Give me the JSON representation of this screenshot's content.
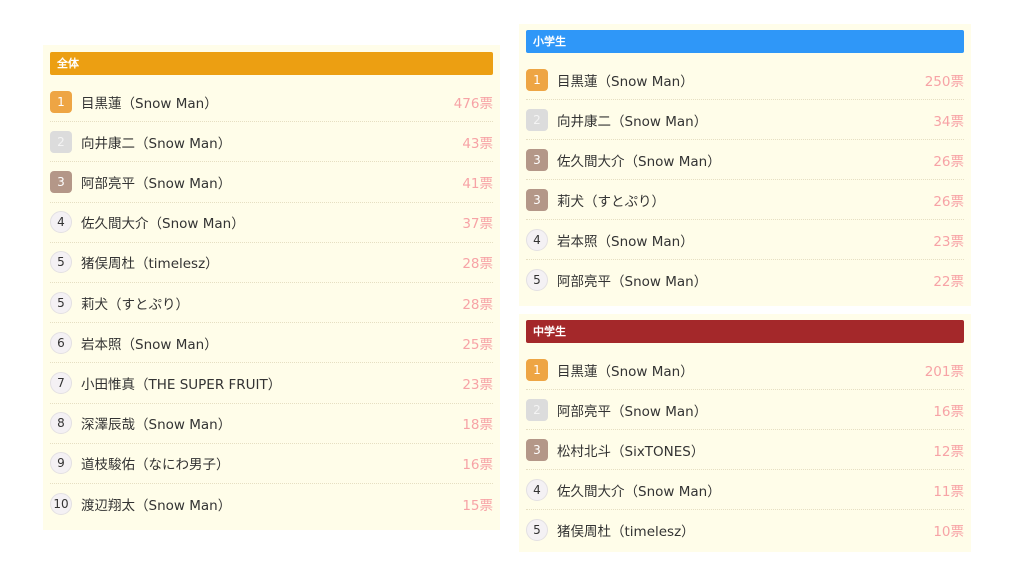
{
  "colors": {
    "all_header": "#ec9f12",
    "elementary_header": "#2f97f8",
    "junior_header": "#a4282a",
    "panel_bg": "#fffde9",
    "votes_text": "#f7a3a6"
  },
  "panels": {
    "all": {
      "title": "全体",
      "rows": [
        {
          "rank": "1",
          "medal": "gold",
          "name": "目黒蓮（Snow Man）",
          "votes": "476票"
        },
        {
          "rank": "2",
          "medal": "silver",
          "name": "向井康二（Snow Man）",
          "votes": "43票"
        },
        {
          "rank": "3",
          "medal": "bronze",
          "name": "阿部亮平（Snow Man）",
          "votes": "41票"
        },
        {
          "rank": "4",
          "medal": "plain",
          "name": "佐久間大介（Snow Man）",
          "votes": "37票"
        },
        {
          "rank": "5",
          "medal": "plain",
          "name": "猪俣周杜（timelesz）",
          "votes": "28票"
        },
        {
          "rank": "5",
          "medal": "plain",
          "name": "莉犬（すとぷり）",
          "votes": "28票"
        },
        {
          "rank": "6",
          "medal": "plain",
          "name": "岩本照（Snow Man）",
          "votes": "25票"
        },
        {
          "rank": "7",
          "medal": "plain",
          "name": "小田惟真（THE SUPER FRUIT）",
          "votes": "23票"
        },
        {
          "rank": "8",
          "medal": "plain",
          "name": "深澤辰哉（Snow Man）",
          "votes": "18票"
        },
        {
          "rank": "9",
          "medal": "plain",
          "name": "道枝駿佑（なにわ男子）",
          "votes": "16票"
        },
        {
          "rank": "10",
          "medal": "plain",
          "name": "渡辺翔太（Snow Man）",
          "votes": "15票"
        }
      ]
    },
    "elementary": {
      "title": "小学生",
      "rows": [
        {
          "rank": "1",
          "medal": "gold",
          "name": "目黒蓮（Snow Man）",
          "votes": "250票"
        },
        {
          "rank": "2",
          "medal": "silver",
          "name": "向井康二（Snow Man）",
          "votes": "34票"
        },
        {
          "rank": "3",
          "medal": "bronze",
          "name": "佐久間大介（Snow Man）",
          "votes": "26票"
        },
        {
          "rank": "3",
          "medal": "bronze",
          "name": "莉犬（すとぷり）",
          "votes": "26票"
        },
        {
          "rank": "4",
          "medal": "plain",
          "name": "岩本照（Snow Man）",
          "votes": "23票"
        },
        {
          "rank": "5",
          "medal": "plain",
          "name": "阿部亮平（Snow Man）",
          "votes": "22票"
        }
      ]
    },
    "junior": {
      "title": "中学生",
      "rows": [
        {
          "rank": "1",
          "medal": "gold",
          "name": "目黒蓮（Snow Man）",
          "votes": "201票"
        },
        {
          "rank": "2",
          "medal": "silver",
          "name": "阿部亮平（Snow Man）",
          "votes": "16票"
        },
        {
          "rank": "3",
          "medal": "bronze",
          "name": "松村北斗（SixTONES）",
          "votes": "12票"
        },
        {
          "rank": "4",
          "medal": "plain",
          "name": "佐久間大介（Snow Man）",
          "votes": "11票"
        },
        {
          "rank": "5",
          "medal": "plain",
          "name": "猪俣周杜（timelesz）",
          "votes": "10票"
        }
      ]
    }
  }
}
